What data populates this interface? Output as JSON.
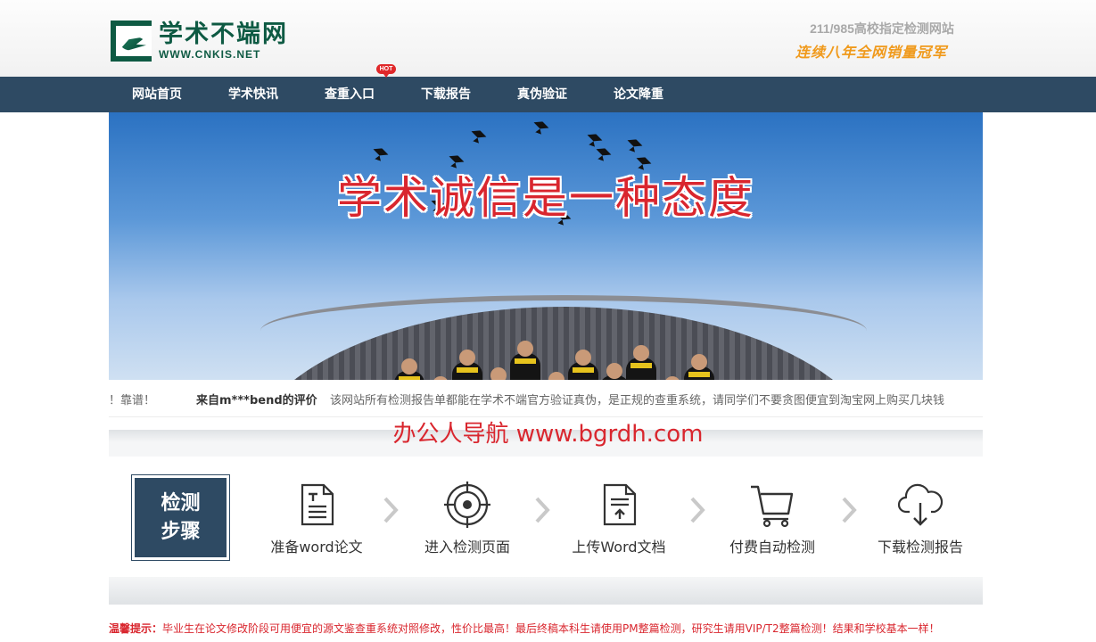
{
  "header": {
    "logo_cn": "学术不端网",
    "logo_en": "WWW.CNKIS.NET",
    "slogan_top": "211/985高校指定检测网站",
    "slogan_bottom": "连续八年全网销量冠军"
  },
  "nav": {
    "items": [
      {
        "label": "网站首页"
      },
      {
        "label": "学术快讯"
      },
      {
        "label": "查重入口"
      },
      {
        "label": "下载报告"
      },
      {
        "label": "真伪验证"
      },
      {
        "label": "论文降重"
      }
    ],
    "hot_badge": "HOT"
  },
  "banner": {
    "title": "学术诚信是一种态度"
  },
  "ticker": {
    "prev_tail": "！靠谱！",
    "from": "来自m***bend的评价",
    "review": "该网站所有检测报告单都能在学术不端官方验证真伪，是正规的查重系统，请同学们不要贪图便宜到淘宝网上购买几块钱"
  },
  "watermark": "办公人导航 www.bgrdh.com",
  "steps": {
    "label_line1": "检测",
    "label_line2": "步骤",
    "items": [
      {
        "label": "准备word论文",
        "icon": "document-icon"
      },
      {
        "label": "进入检测页面",
        "icon": "target-icon"
      },
      {
        "label": "上传Word文档",
        "icon": "upload-file-icon"
      },
      {
        "label": "付费自动检测",
        "icon": "cart-icon"
      },
      {
        "label": "下载检测报告",
        "icon": "cloud-download-icon"
      }
    ]
  },
  "notice": {
    "prefix": "温馨提示：",
    "text": "毕业生在论文修改阶段可用便宜的源文鉴查重系统对照修改，性价比最高！最后终稿本科生请使用PM整篇检测，研究生请用VIP/T2整篇检测！结果和学校基本一样！"
  },
  "colors": {
    "nav_bg": "#2e4a63",
    "brand_green": "#0e5a43",
    "accent_red": "#d9262e",
    "slogan_orange": "#f09a1c"
  }
}
